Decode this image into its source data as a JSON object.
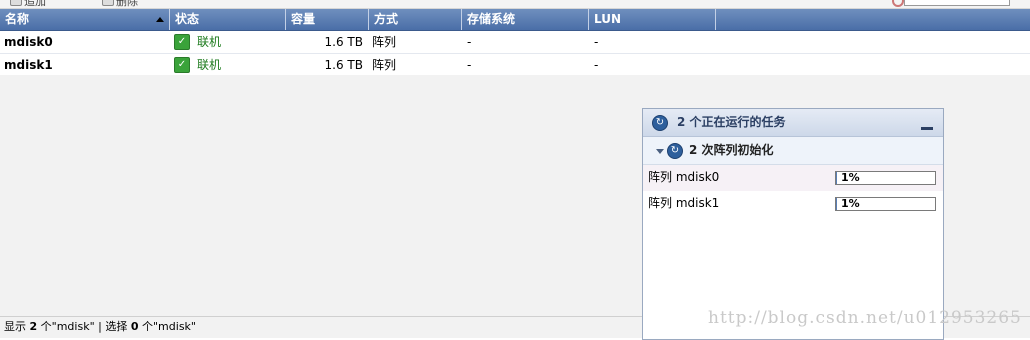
{
  "toolbar": {
    "items": [
      "追加",
      "删除"
    ],
    "search_placeholder": ""
  },
  "grid": {
    "columns": [
      {
        "label": "名称"
      },
      {
        "label": "状态"
      },
      {
        "label": "容量"
      },
      {
        "label": "方式"
      },
      {
        "label": "存储系统"
      },
      {
        "label": "LUN"
      }
    ],
    "rows": [
      {
        "name": "mdisk0",
        "status": "联机",
        "capacity": "1.6 TB",
        "mode": "阵列",
        "storage": "-",
        "lun": "-"
      },
      {
        "name": "mdisk1",
        "status": "联机",
        "capacity": "1.6 TB",
        "mode": "阵列",
        "storage": "-",
        "lun": "-"
      }
    ]
  },
  "statusbar": {
    "prefix": "显示",
    "shown": "2",
    "mid1": "个\"mdisk\" | 选择",
    "selected": "0",
    "mid2": "个\"mdisk\""
  },
  "tasks_panel": {
    "title": "2 个正在运行的任务",
    "group_label": "2 次阵列初始化",
    "tasks": [
      {
        "label": "阵列 mdisk0",
        "progress_text": "1%",
        "progress": 0.01
      },
      {
        "label": "阵列 mdisk1",
        "progress_text": "1%",
        "progress": 0.01
      }
    ]
  },
  "colors": {
    "header": "#4a6ea7",
    "status_green": "#1c7a1c",
    "progress": "#5a7fb6"
  },
  "watermark": "http://blog.csdn.net/u012953265"
}
